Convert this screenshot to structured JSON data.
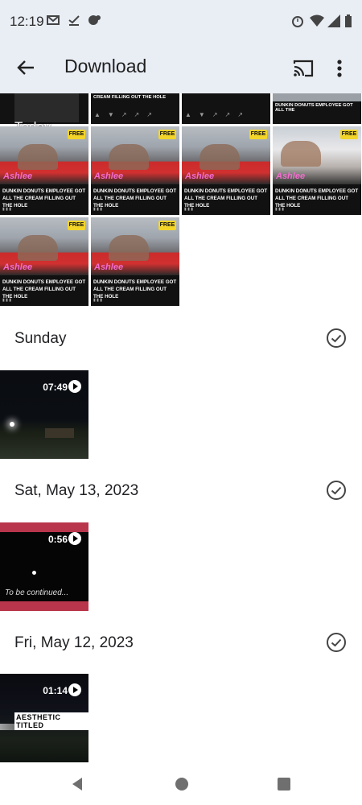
{
  "status": {
    "time": "12:19",
    "icons": [
      "gmail-icon",
      "task-icon",
      "chat-icon",
      "alarm-icon",
      "wifi-icon",
      "signal-icon",
      "battery-icon"
    ]
  },
  "appbar": {
    "title": "Download",
    "back_icon": "arrow-back-icon",
    "cast_icon": "cast-icon",
    "more_icon": "more-vert-icon"
  },
  "groups": {
    "today": {
      "label": "Today",
      "top_strip": [
        {
          "title": "CREAM FILLING OUT THE HOLE"
        },
        {
          "title": ""
        },
        {
          "title": ""
        },
        {
          "title": "DUNKIN DONUTS EMPLOYEE GOT ALL THE"
        }
      ],
      "items": [
        {
          "caption": "DUNKIN DONUTS EMPLOYEE GOT ALL THE CREAM FILLING OUT THE HOLE",
          "badge": "FREE",
          "brand": "Ashlee"
        },
        {
          "caption": "DUNKIN DONUTS EMPLOYEE GOT ALL THE CREAM FILLING OUT THE HOLE",
          "badge": "FREE",
          "brand": "Ashlee"
        },
        {
          "caption": "DUNKIN DONUTS EMPLOYEE GOT ALL THE CREAM FILLING OUT THE HOLE",
          "badge": "FREE",
          "brand": "Ashlee"
        },
        {
          "caption": "DUNKIN DONUTS EMPLOYEE GOT ALL THE CREAM FILLING OUT THE HOLE",
          "badge": "FREE",
          "brand": "Ashlee"
        },
        {
          "caption": "DUNKIN DONUTS EMPLOYEE GOT ALL THE CREAM FILLING OUT THE HOLE",
          "badge": "FREE",
          "brand": "Ashlee"
        },
        {
          "caption": "DUNKIN DONUTS EMPLOYEE GOT ALL THE CREAM FILLING OUT THE HOLE",
          "badge": "FREE",
          "brand": "Ashlee"
        }
      ]
    },
    "sunday": {
      "label": "Sunday",
      "video": {
        "duration": "07:49"
      }
    },
    "may13": {
      "label": "Sat, May 13, 2023",
      "video": {
        "duration": "0:56",
        "overlay": "To be continued..."
      }
    },
    "may12": {
      "label": "Fri, May 12, 2023",
      "video": {
        "duration": "01:14",
        "overlay": "AESTHETIC TITLED"
      }
    }
  },
  "navbar": {
    "back": "nav-back-icon",
    "home": "nav-home-icon",
    "recents": "nav-recents-icon"
  }
}
